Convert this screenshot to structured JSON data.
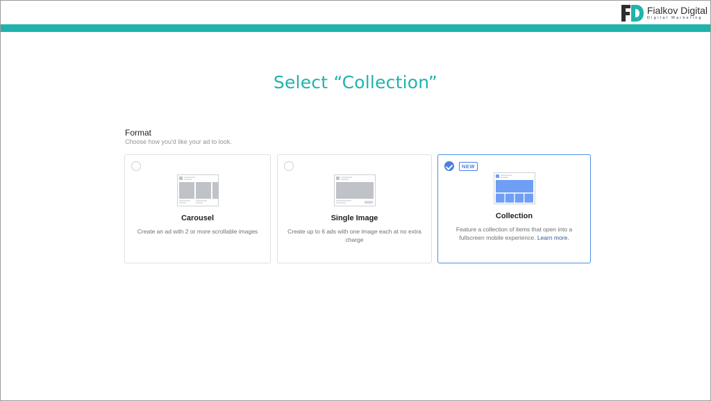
{
  "brand": {
    "name": "Fialkov Digital",
    "subtitle": "Digital Marketing",
    "logo_letters": "FD",
    "colors": {
      "teal": "#1fb3ac",
      "dark": "#2d2d2d"
    }
  },
  "slide": {
    "title": "Select “Collection”"
  },
  "format": {
    "heading": "Format",
    "subheading": "Choose how you'd like your ad to look."
  },
  "options": [
    {
      "title": "Carousel",
      "description": "Create an ad with 2 or more scrollable images",
      "selected": false
    },
    {
      "title": "Single Image",
      "description": "Create up to 6 ads with one image each at no extra charge",
      "selected": false
    },
    {
      "title": "Collection",
      "description": "Feature a collection of items that open into a fullscreen mobile experience.",
      "link": "Learn more.",
      "badge": "NEW",
      "selected": true
    }
  ],
  "colors": {
    "accent": "#4a7fe0",
    "link": "#365899",
    "thumb_gray": "#bfc2c7",
    "thumb_blue": "#6f9ef5"
  }
}
